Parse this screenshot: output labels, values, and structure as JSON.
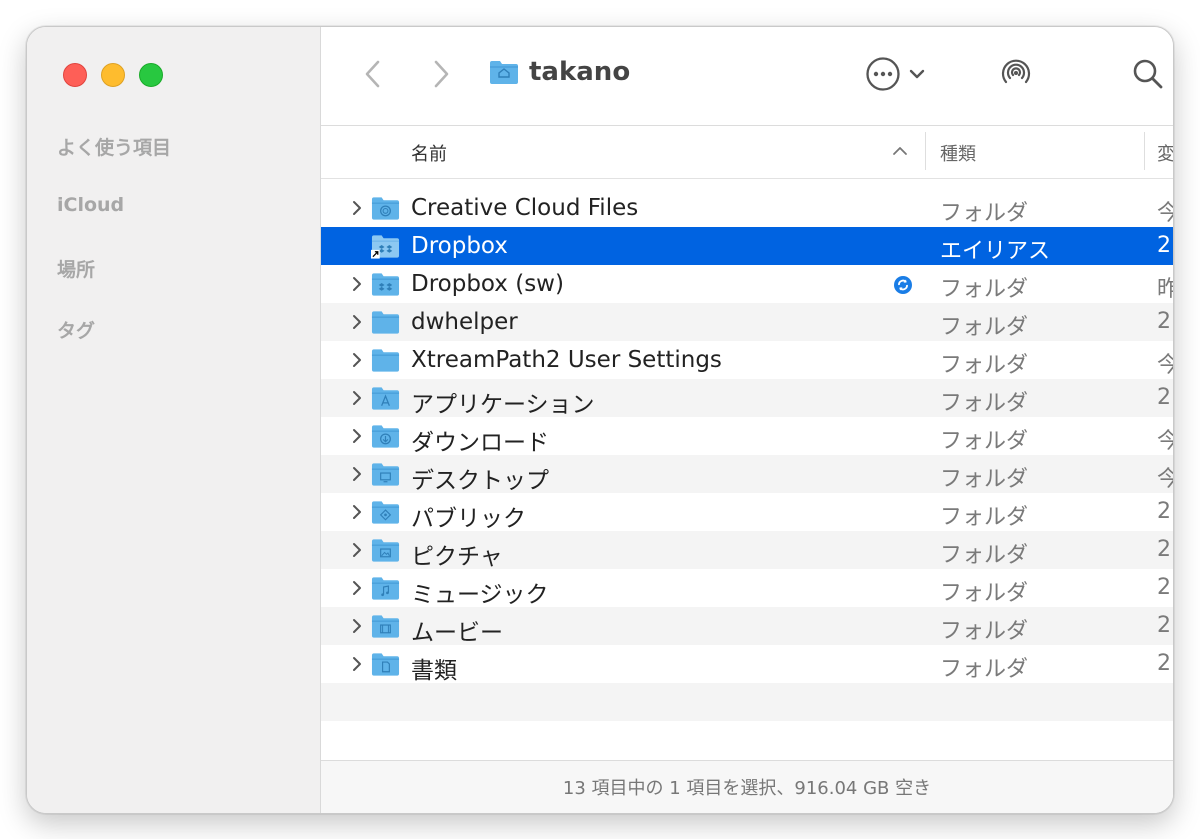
{
  "sidebar": {
    "sections": [
      "よく使う項目",
      "iCloud",
      "場所",
      "タグ"
    ]
  },
  "toolbar": {
    "title": "takano",
    "back_icon": "chevron-left-icon",
    "forward_icon": "chevron-right-icon",
    "more_icon": "ellipsis-circle-icon",
    "airdrop_icon": "airdrop-icon",
    "search_icon": "search-icon"
  },
  "columns": {
    "name": "名前",
    "kind": "種類",
    "date": "変"
  },
  "files": [
    {
      "name": "Creative Cloud Files",
      "kind": "フォルダ",
      "date": "今",
      "icon": "cc-folder-icon"
    },
    {
      "name": "Dropbox",
      "kind": "エイリアス",
      "date": "2",
      "icon": "dropbox-alias-icon",
      "selected": true
    },
    {
      "name": "Dropbox (sw)",
      "kind": "フォルダ",
      "date": "昨",
      "icon": "dropbox-folder-icon",
      "badge": "sync-icon"
    },
    {
      "name": "dwhelper",
      "kind": "フォルダ",
      "date": "2",
      "icon": "folder-icon"
    },
    {
      "name": "XtreamPath2 User Settings",
      "kind": "フォルダ",
      "date": "今",
      "icon": "folder-icon"
    },
    {
      "name": "アプリケーション",
      "kind": "フォルダ",
      "date": "2",
      "icon": "applications-folder-icon"
    },
    {
      "name": "ダウンロード",
      "kind": "フォルダ",
      "date": "今",
      "icon": "downloads-folder-icon"
    },
    {
      "name": "デスクトップ",
      "kind": "フォルダ",
      "date": "今",
      "icon": "desktop-folder-icon"
    },
    {
      "name": "パブリック",
      "kind": "フォルダ",
      "date": "2",
      "icon": "public-folder-icon"
    },
    {
      "name": "ピクチャ",
      "kind": "フォルダ",
      "date": "2",
      "icon": "pictures-folder-icon"
    },
    {
      "name": "ミュージック",
      "kind": "フォルダ",
      "date": "2",
      "icon": "music-folder-icon"
    },
    {
      "name": "ムービー",
      "kind": "フォルダ",
      "date": "2",
      "icon": "movies-folder-icon"
    },
    {
      "name": "書類",
      "kind": "フォルダ",
      "date": "2",
      "icon": "documents-folder-icon"
    }
  ],
  "status": "13 項目中の 1 項目を選択、916.04 GB 空き",
  "colors": {
    "selection": "#0063e1",
    "folder": "#5fb3e9",
    "folder_tab": "#4aa0da"
  }
}
